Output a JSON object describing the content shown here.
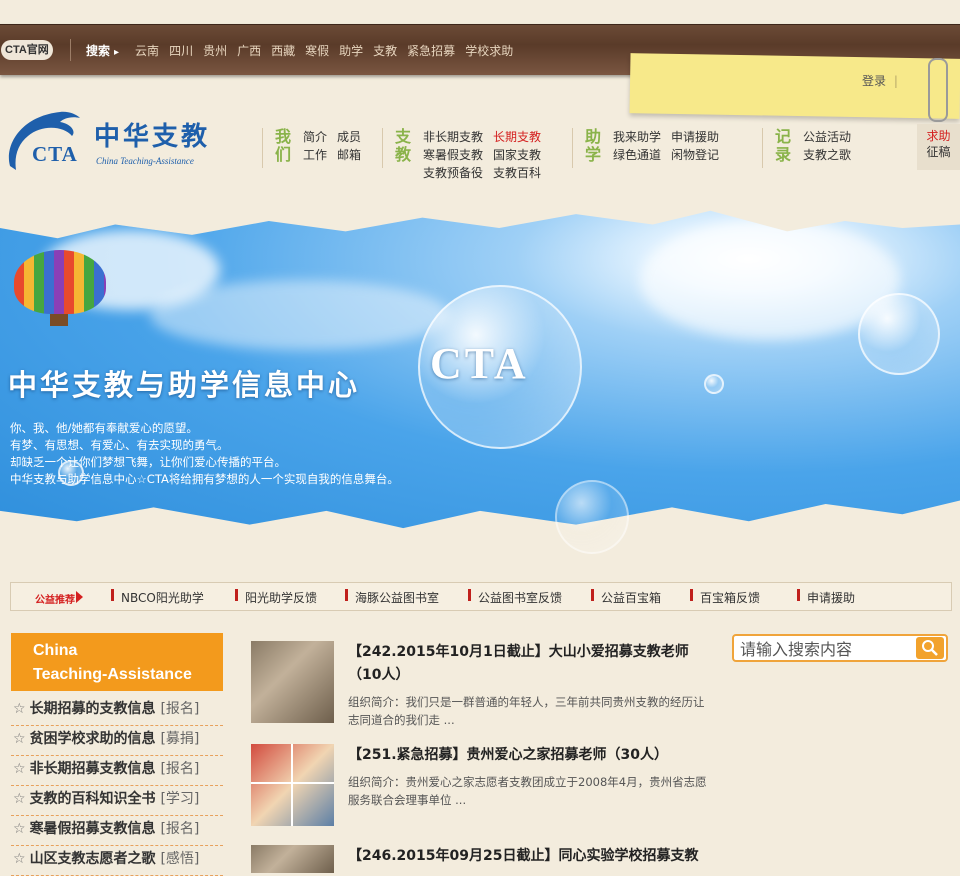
{
  "topbar": {
    "official": "CTA官网",
    "search_label": "搜索",
    "nav": [
      "云南",
      "四川",
      "贵州",
      "广西",
      "西藏",
      "寒假",
      "助学",
      "支教",
      "紧急招募",
      "学校求助"
    ]
  },
  "header": {
    "login": "登录",
    "logo": {
      "cta": "CTA",
      "cn": "中华支教",
      "en": "China Teaching-Assistance"
    }
  },
  "nav_groups": [
    {
      "head": "我们",
      "links": [
        "简介",
        "成员",
        "工作",
        "邮箱"
      ]
    },
    {
      "head": "支教",
      "links": [
        "非长期支教",
        "长期支教",
        "寒暑假支教",
        "国家支教",
        "支教预备役",
        "支教百科"
      ]
    },
    {
      "head": "助学",
      "links": [
        "我来助学",
        "申请援助",
        "绿色通道",
        "闲物登记"
      ]
    },
    {
      "head": "记录",
      "links": [
        "公益活动",
        "支教之歌"
      ]
    }
  ],
  "qiuzhu": {
    "line1": "求助",
    "line2": "征稿"
  },
  "banner": {
    "bubble_text": "CTA",
    "title": "中华支教与助学信息中心",
    "lines": [
      "你、我、他/她都有奉献爱心的愿望。",
      "有梦、有思想、有爱心、有去实现的勇气。",
      "却缺乏一个让你们梦想飞舞，让你们爱心传播的平台。",
      "中华支教与助学信息中心☆CTA将给拥有梦想的人一个实现自我的信息舞台。"
    ]
  },
  "recommend": {
    "label": "公益推荐",
    "items": [
      "NBCO阳光助学",
      "阳光助学反馈",
      "海豚公益图书室",
      "公益图书室反馈",
      "公益百宝箱",
      "百宝箱反馈",
      "申请援助"
    ]
  },
  "sidebar": {
    "title_line1": "China",
    "title_line2": "Teaching-Assistance",
    "items": [
      {
        "label": "长期招募的支教信息",
        "tag": "[报名]"
      },
      {
        "label": "贫困学校求助的信息",
        "tag": "[募捐]"
      },
      {
        "label": "非长期招募支教信息",
        "tag": "[报名]"
      },
      {
        "label": "支教的百科知识全书",
        "tag": "[学习]"
      },
      {
        "label": "寒暑假招募支教信息",
        "tag": "[报名]"
      },
      {
        "label": "山区支教志愿者之歌",
        "tag": "[感悟]"
      }
    ]
  },
  "news": [
    {
      "title": "【242.2015年10月1日截止】大山小爱招募支教老师（10人）",
      "desc": "组织简介：我们只是一群普通的年轻人，三年前共同贵州支教的经历让志同道合的我们走 ..."
    },
    {
      "title": "【251.紧急招募】贵州爱心之家招募老师（30人）",
      "desc": "组织简介：贵州爱心之家志愿者支教团成立于2008年4月，贵州省志愿服务联合会理事单位 ..."
    },
    {
      "title": "【246.2015年09月25日截止】同心实验学校招募支教",
      "desc": ""
    }
  ],
  "search": {
    "placeholder": "请输入搜索内容"
  }
}
